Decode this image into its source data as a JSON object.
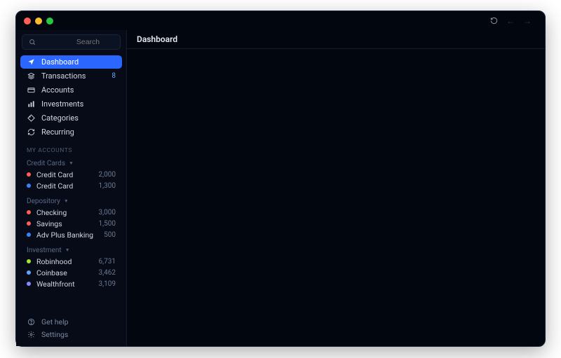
{
  "search": {
    "placeholder": "Search"
  },
  "header": {
    "title": "Dashboard"
  },
  "nav": {
    "dashboard": "Dashboard",
    "transactions": "Transactions",
    "transactions_badge": "8",
    "accounts": "Accounts",
    "investments": "Investments",
    "categories": "Categories",
    "recurring": "Recurring"
  },
  "section_header": "My Accounts",
  "groups": {
    "credit": {
      "label": "Credit Cards",
      "a0": {
        "name": "Credit Card",
        "amt": "2,000",
        "color": "#ff5f57"
      },
      "a1": {
        "name": "Credit Card",
        "amt": "1,300",
        "color": "#3b82f6"
      }
    },
    "depository": {
      "label": "Depository",
      "a0": {
        "name": "Checking",
        "amt": "3,000",
        "color": "#ff5f57"
      },
      "a1": {
        "name": "Savings",
        "amt": "1,500",
        "color": "#ff5f57"
      },
      "a2": {
        "name": "Adv Plus Banking",
        "amt": "500",
        "color": "#3b82f6"
      }
    },
    "investment": {
      "label": "Investment",
      "a0": {
        "name": "Robinhood",
        "amt": "6,731",
        "color": "#a3e635"
      },
      "a1": {
        "name": "Coinbase",
        "amt": "3,462",
        "color": "#60a5fa"
      },
      "a2": {
        "name": "Wealthfront",
        "amt": "3,109",
        "color": "#818cf8"
      }
    }
  },
  "footer": {
    "help": "Get help",
    "settings": "Settings"
  }
}
